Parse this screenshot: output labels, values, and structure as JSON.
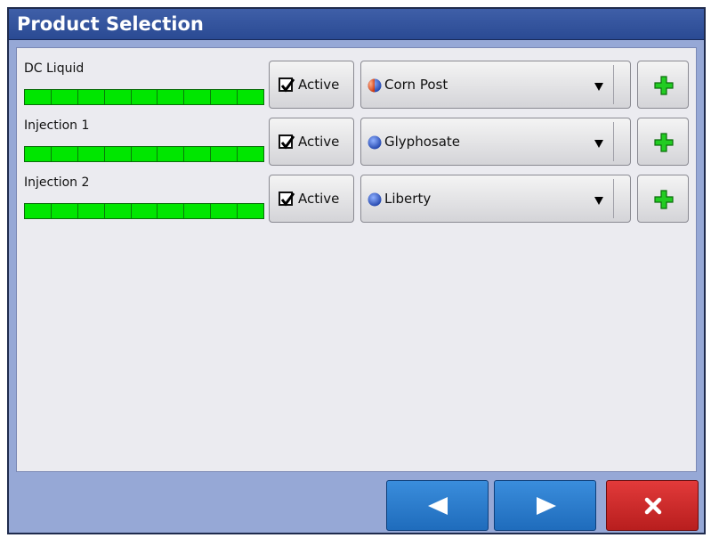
{
  "window": {
    "title": "Product Selection"
  },
  "products": [
    {
      "label": "DC Liquid",
      "active_label": "Active",
      "active_checked": true,
      "product": "Corn Post",
      "product_icon": "half-red-blue-sphere-icon"
    },
    {
      "label": "Injection 1",
      "active_label": "Active",
      "active_checked": true,
      "product": "Glyphosate",
      "product_icon": "blue-sphere-icon"
    },
    {
      "label": "Injection 2",
      "active_label": "Active",
      "active_checked": true,
      "product": "Liberty",
      "product_icon": "blue-sphere-icon"
    }
  ],
  "footer": {
    "back_icon": "left-arrow-icon",
    "next_icon": "right-arrow-icon",
    "cancel_icon": "close-icon"
  },
  "colors": {
    "title_bar": "#2f4f9e",
    "window_bg": "#96a8d6",
    "content_bg": "#ebebf0",
    "section_bar": "#00e600",
    "nav_blue": "#2a7ccc",
    "cancel_red": "#cc2a2a",
    "add_green": "#22cc22"
  }
}
